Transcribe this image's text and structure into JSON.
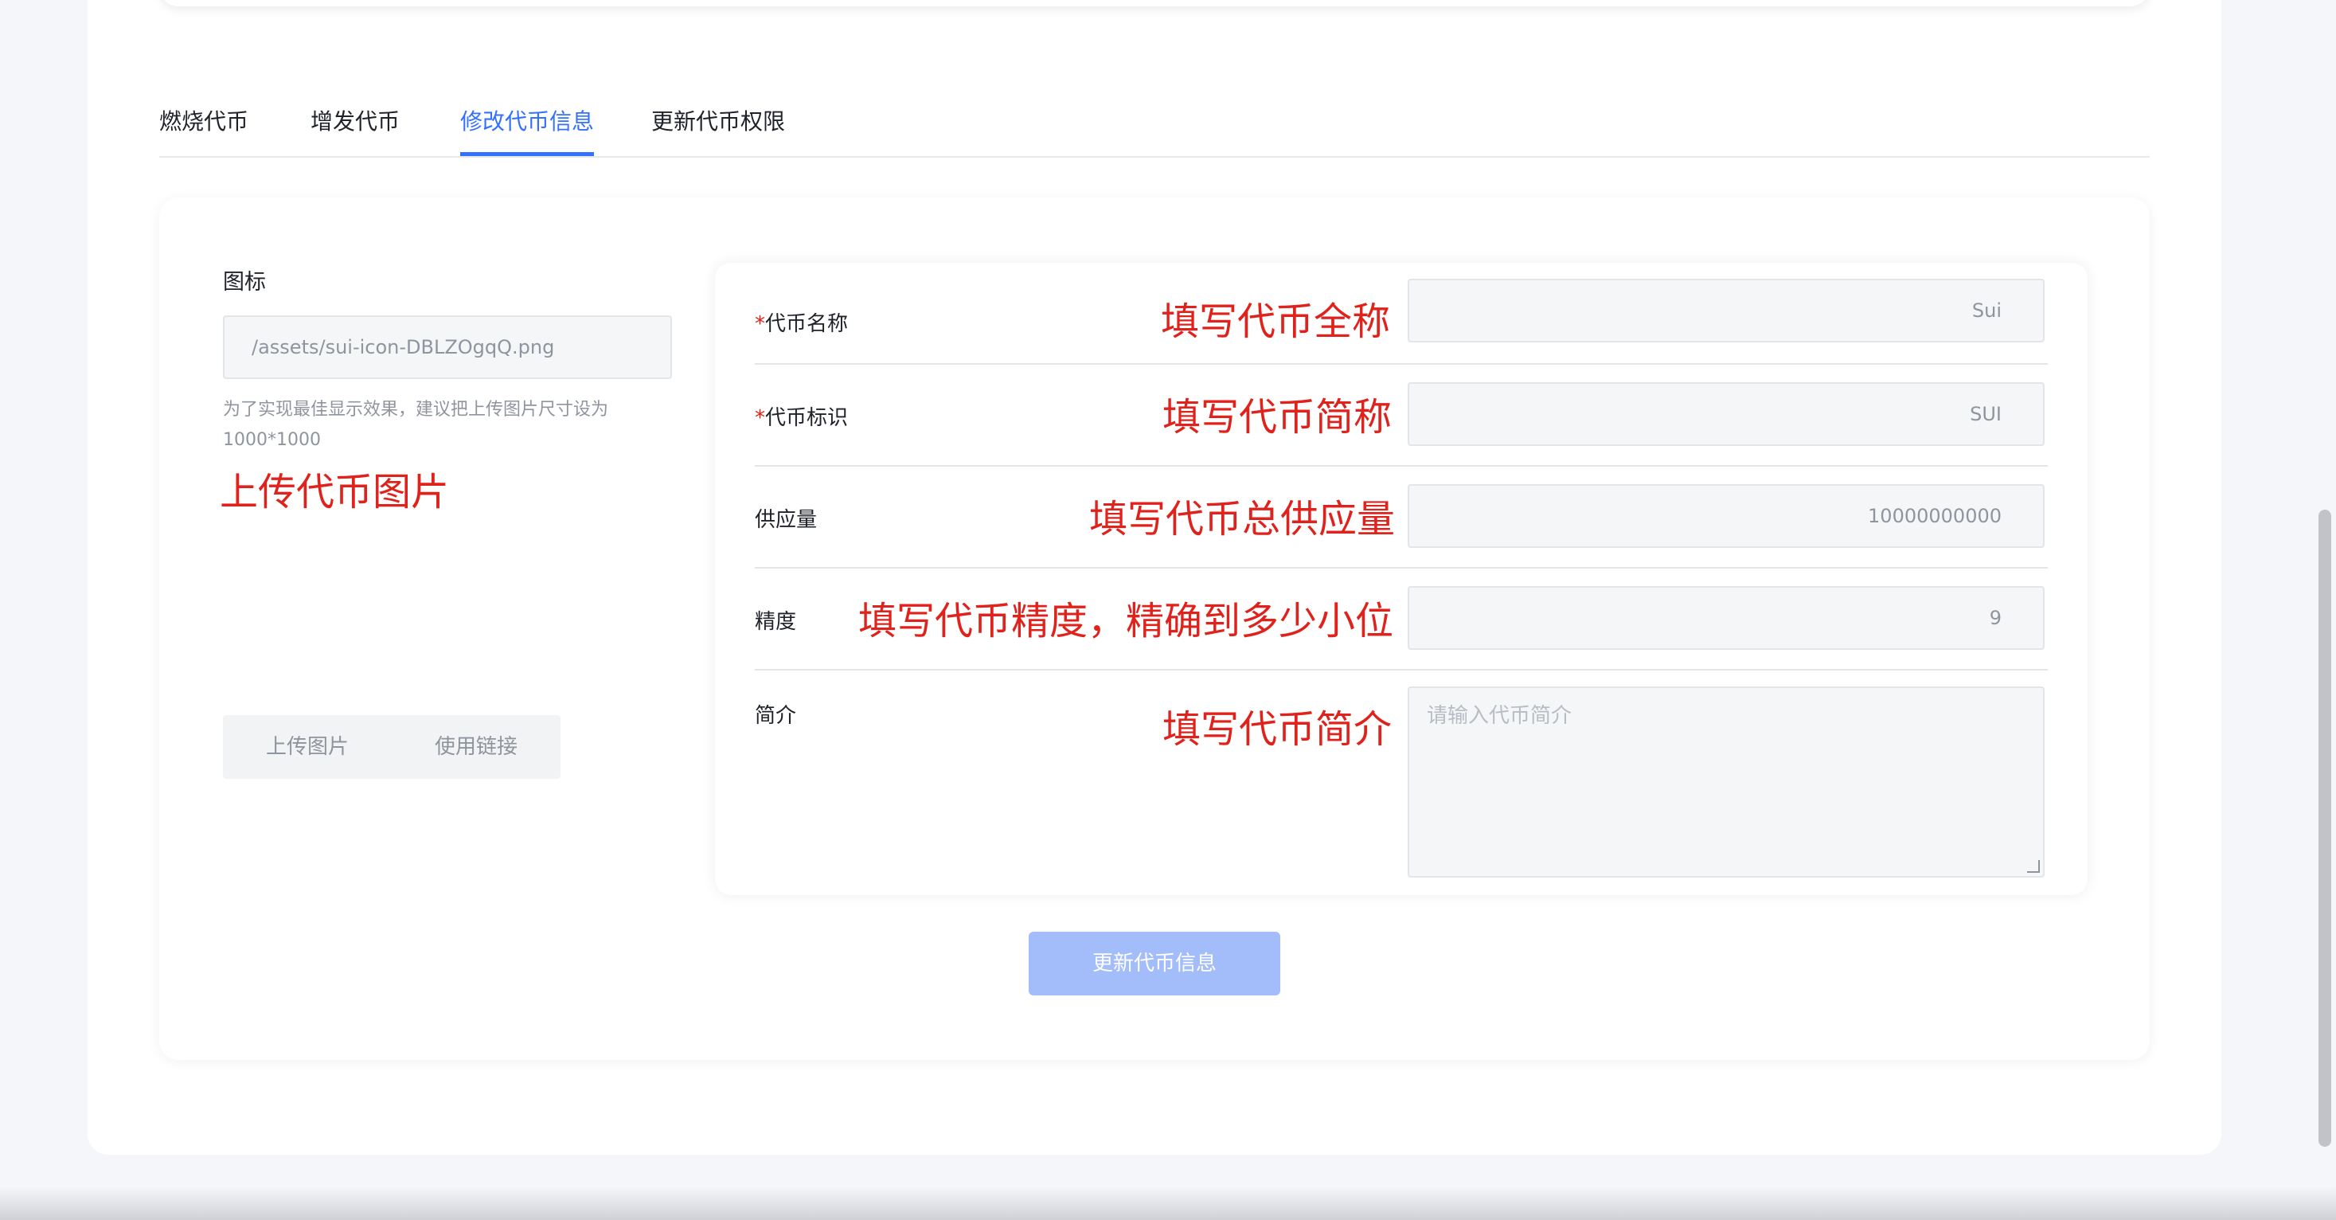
{
  "tabs": [
    {
      "label": "燃烧代币"
    },
    {
      "label": "增发代币"
    },
    {
      "label": "修改代币信息"
    },
    {
      "label": "更新代币权限"
    }
  ],
  "icon_section": {
    "label": "图标",
    "path": "/assets/sui-icon-DBLZOgqQ.png",
    "hint": "为了实现最佳显示效果，建议把上传图片尺寸设为1000*1000",
    "annotation": "上传代币图片",
    "upload_label": "上传图片",
    "link_label": "使用链接"
  },
  "form": {
    "name": {
      "required_mark": "*",
      "label": "代币名称",
      "value": "Sui",
      "annotation": "填写代币全称"
    },
    "symbol": {
      "required_mark": "*",
      "label": "代币标识",
      "value": "SUI",
      "annotation": "填写代币简称"
    },
    "supply": {
      "label": "供应量",
      "value": "10000000000",
      "annotation": "填写代币总供应量"
    },
    "decimals": {
      "label": "精度",
      "value": "9",
      "annotation": "填写代币精度，精确到多少小位"
    },
    "description": {
      "label": "简介",
      "placeholder": "请输入代币简介",
      "annotation": "填写代币简介"
    }
  },
  "submit_label": "更新代币信息",
  "colors": {
    "accent": "#3370ff",
    "annotation": "#e0221c",
    "button_disabled": "#a3bdfa"
  }
}
